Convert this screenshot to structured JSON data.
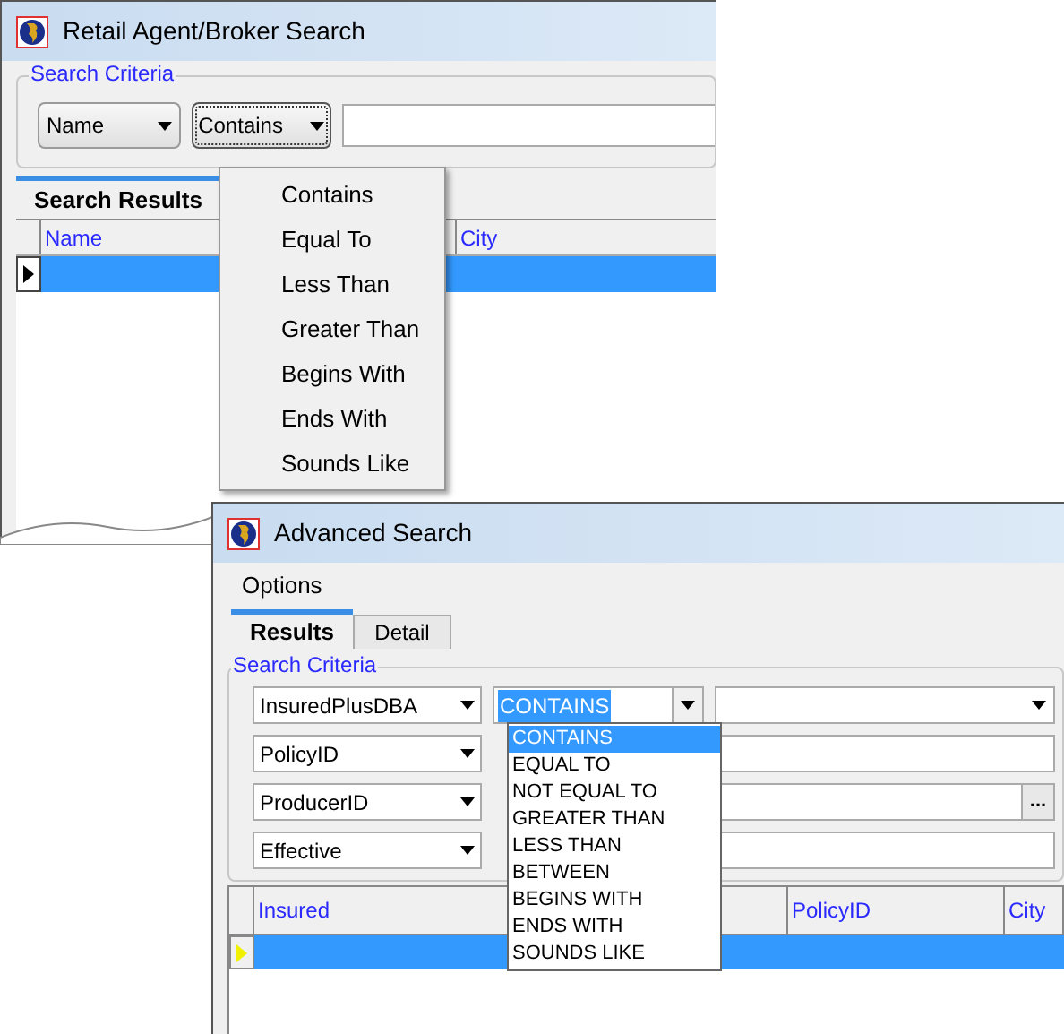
{
  "retail_search": {
    "title": "Retail Agent/Broker Search",
    "group_label": "Search Criteria",
    "field_combo": "Name",
    "operator_combo": "Contains",
    "operator_menu": [
      {
        "label": "Contains",
        "selected": false
      },
      {
        "label": "Equal To",
        "selected": false
      },
      {
        "label": "Less Than",
        "selected": false
      },
      {
        "label": "Greater Than",
        "selected": false
      },
      {
        "label": "Begins With",
        "selected": false
      },
      {
        "label": "Ends With",
        "selected": false
      },
      {
        "label": "Sounds Like",
        "selected": false
      }
    ],
    "tabs": [
      {
        "label": "Search Results",
        "selected": true
      }
    ],
    "table": {
      "columns": [
        "Name",
        "City"
      ],
      "rows": [
        {
          "selected": true
        }
      ]
    }
  },
  "advanced_search": {
    "title": "Advanced Search",
    "menu": [
      "Options"
    ],
    "tabs": [
      {
        "label": "Results",
        "selected": true
      },
      {
        "label": "Detail",
        "selected": false
      }
    ],
    "group_label": "Search Criteria",
    "criteria": [
      {
        "field": "InsuredPlusDBA",
        "kind": "dropdown"
      },
      {
        "field": "PolicyID",
        "kind": "text"
      },
      {
        "field": "ProducerID",
        "kind": "browse",
        "browse_label": "..."
      },
      {
        "field": "Effective",
        "kind": "text"
      }
    ],
    "operator_combo": "CONTAINS",
    "operator_list": [
      {
        "label": "CONTAINS",
        "selected": true
      },
      {
        "label": "EQUAL TO",
        "selected": false
      },
      {
        "label": "NOT EQUAL TO",
        "selected": false
      },
      {
        "label": "GREATER THAN",
        "selected": false
      },
      {
        "label": "LESS THAN",
        "selected": false
      },
      {
        "label": "BETWEEN",
        "selected": false
      },
      {
        "label": "BEGINS WITH",
        "selected": false
      },
      {
        "label": "ENDS WITH",
        "selected": false
      },
      {
        "label": "SOUNDS LIKE",
        "selected": false
      }
    ],
    "table": {
      "columns": [
        "Insured",
        "PolicyID",
        "City"
      ],
      "rows": [
        {
          "selected": true
        }
      ]
    }
  }
}
